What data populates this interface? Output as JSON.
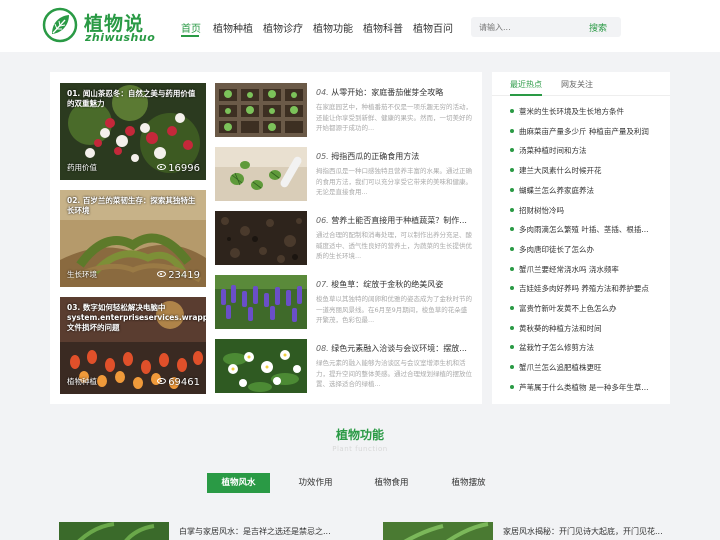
{
  "header": {
    "logo_cn": "植物说",
    "logo_en": "zhiwushuo",
    "nav": [
      "首页",
      "植物种植",
      "植物诊疗",
      "植物功能",
      "植物科普",
      "植物百问"
    ],
    "active_nav": "首页",
    "search_placeholder": "请输入...",
    "search_button": "搜索"
  },
  "featured": [
    {
      "title": "01. 闻山茶忍冬：自然之美与药用价值的双重魅力",
      "category": "药用价值",
      "views": "16996"
    },
    {
      "title": "02. 百岁兰的菜韧生存：探索其独特生长环境",
      "category": "生长环境",
      "views": "23419"
    },
    {
      "title": "03. 数字如何轻松解决电脑中system.enterpriseservices.wrapper.dll文件损坏的问题",
      "category": "植物种植",
      "views": "69461"
    }
  ],
  "articles": [
    {
      "num": "04.",
      "title": "从零开始：家庭番茄催芽全攻略",
      "desc": "在家庭园艺中，种植番茄不仅是一项乐趣无穷的活动，还能让你享受到新鲜、健康的果实。然而，一切美好的开始都源于成功的..."
    },
    {
      "num": "05.",
      "title": "拇指西瓜的正确食用方法",
      "desc": "拇指西瓜是一种口感独特且营养丰富的水果。通过正确的食用方法，我们可以充分享受它带来的美味和健康。无论是直接食用..."
    },
    {
      "num": "06.",
      "title": "营养土能否直接用于种植蔬菜？制作...",
      "desc": "通过合理的配制和消毒处理，可以制作出养分充足、酸碱度适中、透气性良好的营养土，为蔬菜的生长提供优质的生长环境..."
    },
    {
      "num": "07.",
      "title": "梭鱼草：绽放于金秋的绝美风姿",
      "desc": "梭鱼草以其独特的阔卵和优雅的姿态成为了金秋时节的一道亮丽风景线。在6月至9月期间，梭鱼草的花朵盛开繁茂，色彩包最..."
    },
    {
      "num": "08.",
      "title": "绿色元素融入洽谈与会议环境：摆放...",
      "desc": "绿色元素的融入能够为洽谈区与会议室增添生机和活力，提升空间的整体美感。通过合理规划绿植的摆放位置、选择适合的绿植..."
    }
  ],
  "sidebar": {
    "tabs": [
      "最近热点",
      "网友关注"
    ],
    "items": [
      "薏米的生长环境及生长地方条件",
      "曲麻菜亩产量多少斤 种植亩产量及利润",
      "汤菜种植时间和方法",
      "建兰大凤素什么时候开花",
      "蝴蝶兰怎么养家庭养法",
      "招财树怡冷吗",
      "多肉雨滴怎么繁殖 叶插、茎插、根插...",
      "多肉唐印徒长了怎么办",
      "蟹爪兰要经常浇水吗 浇水频率",
      "吉娃娃多肉好养吗 养殖方法和养护要点",
      "富贵竹新叶发黄不上色怎么办",
      "黄秋葵的种植方法和时间",
      "盆栽竹子怎么修剪方法",
      "蟹爪兰怎么追肥植株更旺",
      "芦苇属于什么类植物 是一种多年生草..."
    ]
  },
  "section": {
    "title": "植物功能",
    "subtitle": "Plant function",
    "tabs": [
      "植物风水",
      "功效作用",
      "植物食用",
      "植物摆放"
    ]
  },
  "bottom_articles": [
    {
      "title": "白掌与家居风水：是吉祥之选还是禁忌之..."
    },
    {
      "title": "家居风水揭秘：开门见诗大起底，开门见花..."
    }
  ]
}
